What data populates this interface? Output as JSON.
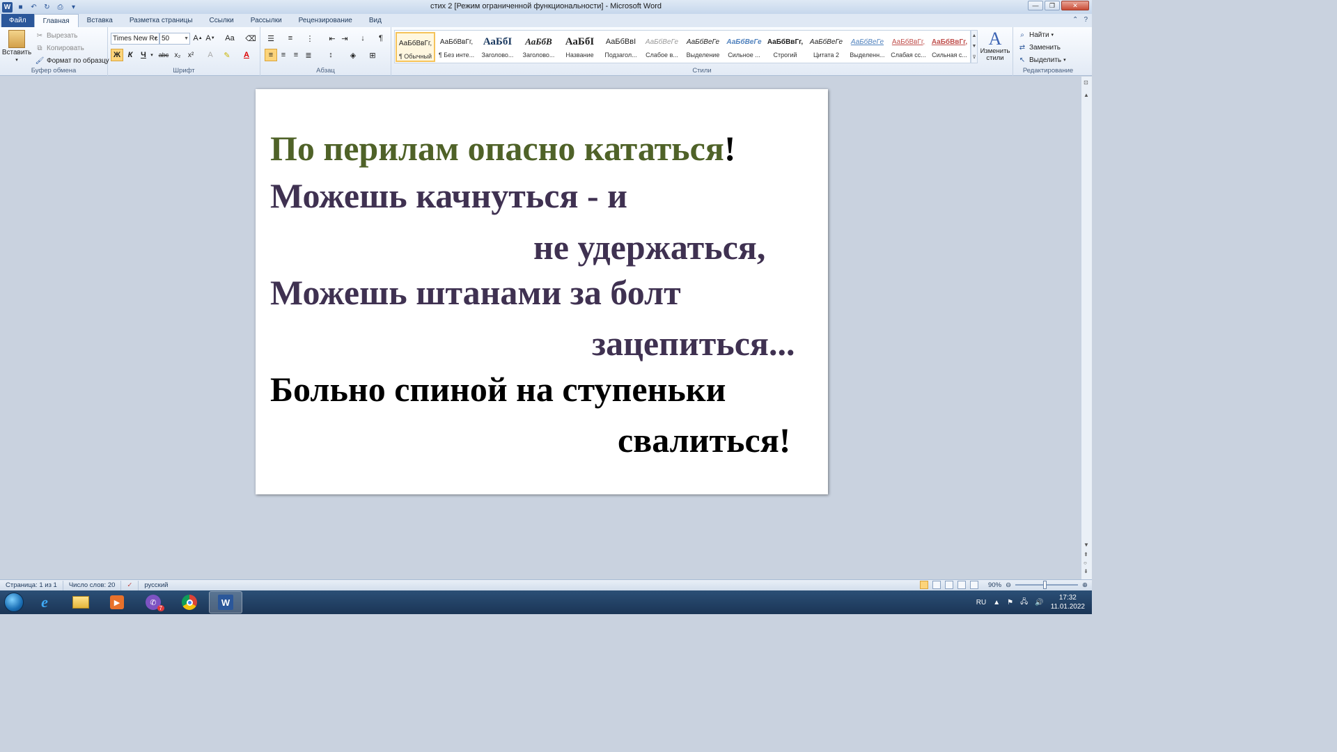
{
  "window": {
    "title": "стих 2 [Режим ограниченной функциональности] - Microsoft Word",
    "logo_letter": "W"
  },
  "tabs": [
    {
      "label": "Файл"
    },
    {
      "label": "Главная"
    },
    {
      "label": "Вставка"
    },
    {
      "label": "Разметка страницы"
    },
    {
      "label": "Ссылки"
    },
    {
      "label": "Рассылки"
    },
    {
      "label": "Рецензирование"
    },
    {
      "label": "Вид"
    }
  ],
  "clipboard": {
    "paste": "Вставить",
    "cut": "Вырезать",
    "copy": "Копировать",
    "format_painter": "Формат по образцу",
    "group_label": "Буфер обмена"
  },
  "font": {
    "family": "Times New Rc",
    "size": "50",
    "group_label": "Шрифт",
    "bold": "Ж",
    "italic": "К",
    "underline": "Ч",
    "strike": "abc",
    "subscript": "x₂",
    "superscript": "x²",
    "case": "Aa"
  },
  "paragraph": {
    "group_label": "Абзац",
    "pilcrow": "¶"
  },
  "styles": {
    "group_label": "Стили",
    "items": [
      {
        "sample": "АаБбВвГг,",
        "name": "¶ Обычный"
      },
      {
        "sample": "АаБбВвГг,",
        "name": "¶ Без инте..."
      },
      {
        "sample": "АаБбI",
        "name": "Заголово..."
      },
      {
        "sample": "АаБбВ",
        "name": "Заголово..."
      },
      {
        "sample": "АаБбI",
        "name": "Название"
      },
      {
        "sample": "АаБбВвI",
        "name": "Подзагол..."
      },
      {
        "sample": "АаБбВеГе",
        "name": "Слабое в..."
      },
      {
        "sample": "АаБбВеГе",
        "name": "Выделение"
      },
      {
        "sample": "АаБбВеГе",
        "name": "Сильное ..."
      },
      {
        "sample": "АаБбВвГг,",
        "name": "Строгий"
      },
      {
        "sample": "АаБбВеГе",
        "name": "Цитата 2"
      },
      {
        "sample": "АаБбВеГе",
        "name": "Выделенн..."
      },
      {
        "sample": "АаБбВвГг,",
        "name": "Слабая сс..."
      },
      {
        "sample": "АаБбВвГг,",
        "name": "Сильная с..."
      }
    ],
    "change_styles": "Изменить стили"
  },
  "editing": {
    "group_label": "Редактирование",
    "find": "Найти",
    "replace": "Заменить",
    "select": "Выделить"
  },
  "document": {
    "lines": [
      {
        "text": "По перилам опасно кататься",
        "tail": "!"
      },
      {
        "text": "Можешь качнуться - и"
      },
      {
        "text": "не  удержаться,"
      },
      {
        "text": "Можешь штанами за болт"
      },
      {
        "text": "зацепиться..."
      },
      {
        "text": "Больно спиной на ступеньки"
      },
      {
        "text": "свалиться!"
      }
    ],
    "colors": {
      "olive": "#4f6228",
      "purple": "#3f3151",
      "black": "#000000"
    }
  },
  "statusbar": {
    "page": "Страница: 1 из 1",
    "words": "Число слов: 20",
    "language": "русский",
    "zoom": "90%"
  },
  "taskbar": {
    "viber_badge": "7",
    "lang": "RU",
    "time": "17:32",
    "date": "11.01.2022"
  }
}
